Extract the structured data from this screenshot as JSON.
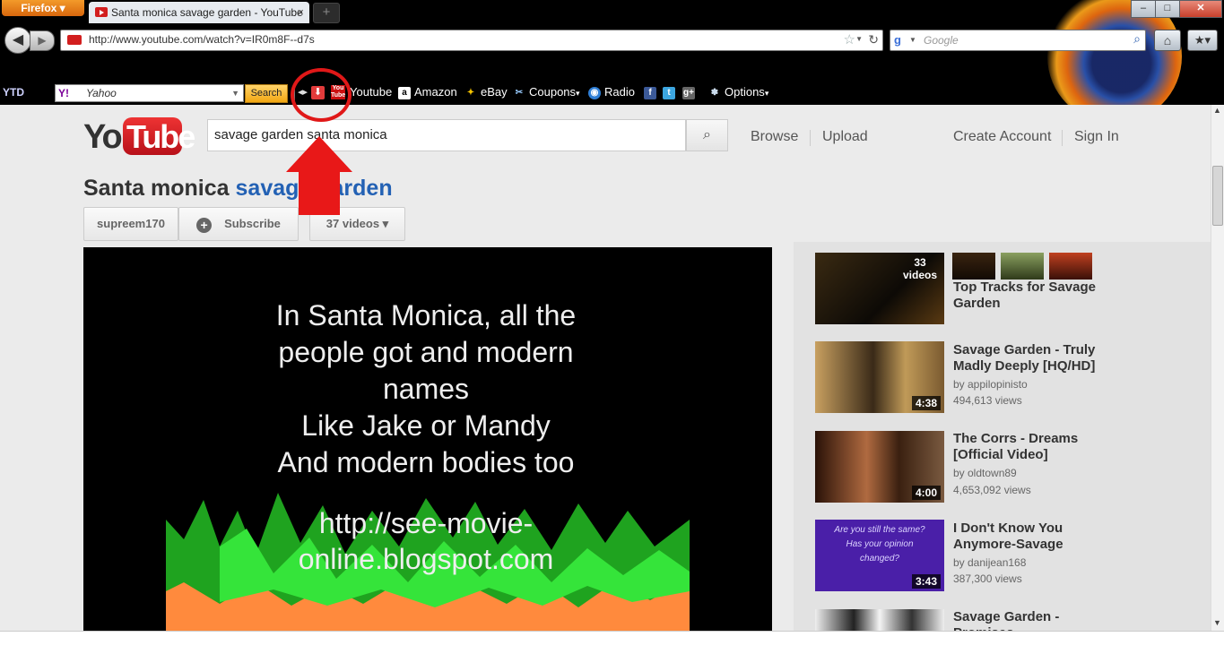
{
  "browser": {
    "menu_label": "Firefox",
    "tab_title": "Santa monica savage garden - YouTube",
    "tab_close": "×",
    "new_tab": "+",
    "url": "http://www.youtube.com/watch?v=IR0m8F--d7s",
    "search_placeholder": "Google",
    "window_controls": {
      "minimize": "–",
      "maximize": "□",
      "close": "✕"
    }
  },
  "toolbar": {
    "ytd_label": "YTD",
    "yahoo_logo": "Y!",
    "yahoo_placeholder": "Yahoo",
    "search_button": "Search",
    "items": [
      {
        "label": "Youtube"
      },
      {
        "label": "Amazon"
      },
      {
        "label": "eBay"
      },
      {
        "label": "Coupons"
      },
      {
        "label": "Radio"
      },
      {
        "label": "Options"
      }
    ]
  },
  "youtube": {
    "logo_you": "You",
    "logo_tube": "Tube",
    "search_value": "savage garden santa monica",
    "nav": {
      "browse": "Browse",
      "upload": "Upload",
      "create_account": "Create Account",
      "sign_in": "Sign In"
    },
    "video_title_black": "Santa monica",
    "video_title_blue": "savage garden",
    "channel": "supreem170",
    "subscribe": "Subscribe",
    "videos_count": "37 videos ▾"
  },
  "player": {
    "lyric_lines": [
      "In Santa Monica, all the",
      "people got and modern",
      "names",
      "Like Jake or Mandy",
      "And modern bodies too"
    ],
    "url_lines": [
      "http://see-movie-",
      "online.blogspot.com"
    ]
  },
  "sidebar": {
    "playlist": {
      "count": "33",
      "count_label": "videos",
      "title": "Top Tracks for Savage Garden"
    },
    "videos": [
      {
        "title": "Savage Garden - Truly Madly Deeply [HQ/HD]",
        "by": "by appilopinisto",
        "views": "494,613 views",
        "duration": "4:38"
      },
      {
        "title": "The Corrs - Dreams [Official Video]",
        "by": "by oldtown89",
        "views": "4,653,092 views",
        "duration": "4:00"
      },
      {
        "title": "I Don't Know You Anymore-Savage",
        "by": "by danijean168",
        "views": "387,300 views",
        "duration": "3:43",
        "thumb_text": "Are you still the same? Has your opinion changed?"
      },
      {
        "title": "Savage Garden - Promises",
        "by": "",
        "views": "",
        "duration": ""
      }
    ]
  },
  "colors": {
    "youtube_red": "#cc181e",
    "link_blue": "#2361b4",
    "annotation_red": "#e81818"
  }
}
